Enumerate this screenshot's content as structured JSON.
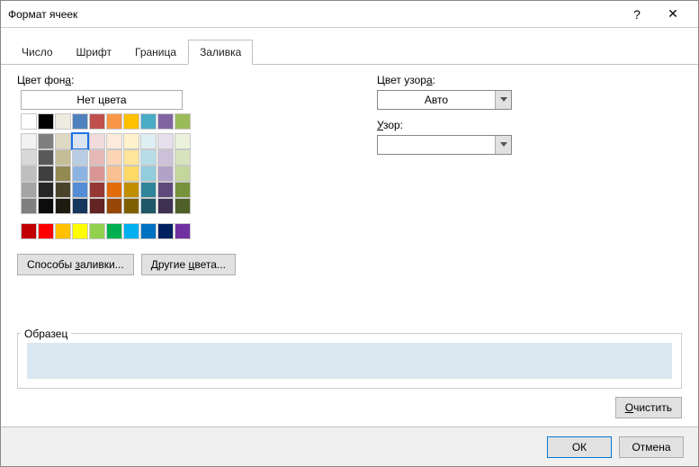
{
  "title": "Формат ячеек",
  "help_glyph": "?",
  "close_glyph": "✕",
  "tabs": [
    "Число",
    "Шрифт",
    "Граница",
    "Заливка"
  ],
  "active_tab_index": 3,
  "left": {
    "bgcolor_label_pre": "Цвет фон",
    "bgcolor_label_ul": "а",
    "bgcolor_label_post": ":",
    "no_color": "Нет цвета",
    "theme_row": [
      "#ffffff",
      "#000000",
      "#eeece1",
      "#4f81bd",
      "#c0504d",
      "#f79646",
      "#ffc000",
      "#4bacc6",
      "#8064a2",
      "#9bbb59"
    ],
    "tints": [
      [
        "#f2f2f2",
        "#7f7f7f",
        "#ddd9c3",
        "#dbe5f1",
        "#f2dcdb",
        "#fdeada",
        "#fff2cc",
        "#deeef3",
        "#e5e0ec",
        "#ebf1dd"
      ],
      [
        "#d8d8d8",
        "#595959",
        "#c4bd97",
        "#b8cce4",
        "#e5b9b7",
        "#fbd5b5",
        "#ffe599",
        "#b7dee8",
        "#ccc1d9",
        "#d7e3bc"
      ],
      [
        "#bfbfbf",
        "#3f3f3f",
        "#938953",
        "#8db3e2",
        "#d99694",
        "#fac08f",
        "#ffd966",
        "#92cddc",
        "#b2a2c7",
        "#c3d69b"
      ],
      [
        "#a5a5a5",
        "#262626",
        "#494429",
        "#548dd4",
        "#953734",
        "#e36c09",
        "#bf8f00",
        "#31859b",
        "#5f497a",
        "#76923c"
      ],
      [
        "#7f7f7f",
        "#0c0c0c",
        "#1d1b10",
        "#17365d",
        "#632423",
        "#974806",
        "#7f6000",
        "#205867",
        "#3f3151",
        "#4f6128"
      ]
    ],
    "selected": {
      "group": "tints",
      "row": 0,
      "col": 3
    },
    "standard": [
      "#c00000",
      "#ff0000",
      "#ffc000",
      "#ffff00",
      "#92d050",
      "#00b050",
      "#00b0f0",
      "#0070c0",
      "#002060",
      "#7030a0"
    ],
    "fill_effects_btn": "Способы заливки...",
    "fill_effects_ul_index": 8,
    "more_colors_btn": "Другие цвета...",
    "more_colors_ul_index": 7
  },
  "right": {
    "pattern_color_label_pre": "Цвет узор",
    "pattern_color_label_ul": "а",
    "pattern_color_label_post": ":",
    "pattern_color_value": "Авто",
    "pattern_label_pre": "",
    "pattern_label_ul": "У",
    "pattern_label_post": "зор:",
    "pattern_value": ""
  },
  "sample_label": "Образец",
  "sample_color": "#dbe7f0",
  "clear_btn": "Очистить",
  "clear_ul_index": 0,
  "ok_btn": "ОК",
  "cancel_btn": "Отмена"
}
